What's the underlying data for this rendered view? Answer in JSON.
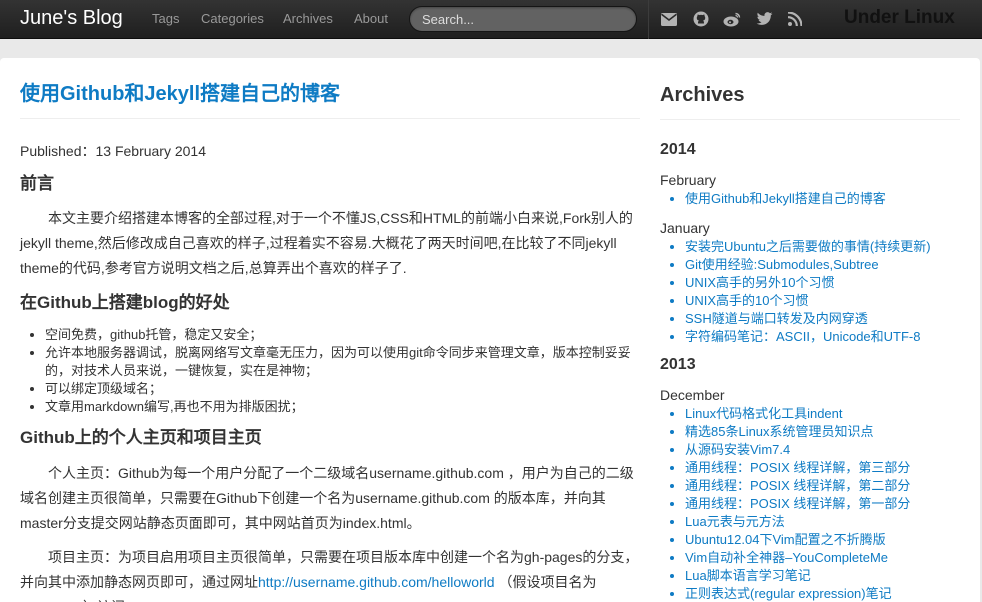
{
  "navbar": {
    "brand": "June's Blog",
    "links": [
      "Tags",
      "Categories",
      "Archives",
      "About"
    ],
    "search_placeholder": "Search...",
    "icons": [
      "envelope-icon",
      "github-icon",
      "weibo-icon",
      "twitter-icon",
      "rss-icon"
    ],
    "right_text": "Under Linux"
  },
  "colors": {
    "link": "#0e7bc4",
    "navbar": "#2b2b2b",
    "background": "#e9e9e9"
  },
  "post": {
    "title": "使用Github和Jekyll搭建自己的博客",
    "published": "Published：13 February 2014",
    "sections": [
      {
        "heading": "前言",
        "para": "本文主要介绍搭建本博客的全部过程,对于一个不懂JS,CSS和HTML的前端小白来说,Fork别人的jekyll theme,然后修改成自己喜欢的样子,过程着实不容易.大概花了两天时间吧,在比较了不同jekyll theme的代码,参考官方说明文档之后,总算弄出个喜欢的样子了."
      },
      {
        "heading": "在Github上搭建blog的好处",
        "items": [
          "空间免费，github托管，稳定又安全；",
          "允许本地服务器调试，脱离网络写文章毫无压力，因为可以使用git命令同步来管理文章，版本控制妥妥的，对技术人员来说，一键恢复，实在是神物；",
          "可以绑定顶级域名；",
          "文章用markdown编写,再也不用为排版困扰；"
        ]
      },
      {
        "heading": "Github上的个人主页和项目主页",
        "para1": "个人主页：Github为每一个用户分配了一个二级域名username.github.com ，用户为自己的二级域名创建主页很简单，只需要在Github下创建一个名为username.github.com 的版本库，并向其master分支提交网站静态页面即可，其中网站首页为index.html。",
        "para2_before": "项目主页：为项目启用项目主页很简单，只需要在项目版本库中创建一个名为gh-pages的分支，并向其中添加静态网页即可，通过网址",
        "para2_link": "http://username.github.com/helloworld",
        "para2_after": " （假设项目名为helloworld）访问。"
      }
    ]
  },
  "sidebar": {
    "title": "Archives",
    "years": [
      {
        "year": "2014",
        "months": [
          {
            "month": "February",
            "posts": [
              "使用Github和Jekyll搭建自己的博客"
            ]
          },
          {
            "month": "January",
            "posts": [
              "安装完Ubuntu之后需要做的事情(持续更新)",
              "Git使用经验:Submodules,Subtree",
              "UNIX高手的另外10个习惯",
              "UNIX高手的10个习惯",
              "SSH隧道与端口转发及内网穿透",
              "字符编码笔记：ASCII，Unicode和UTF-8"
            ]
          }
        ]
      },
      {
        "year": "2013",
        "months": [
          {
            "month": "December",
            "posts": [
              "Linux代码格式化工具indent",
              "精选85条Linux系统管理员知识点",
              "从源码安装Vim7.4",
              "通用线程：POSIX 线程详解，第三部分",
              "通用线程：POSIX 线程详解，第二部分",
              "通用线程：POSIX 线程详解，第一部分",
              "Lua元表与元方法",
              "Ubuntu12.04下Vim配置之不折腾版",
              "Vim自动补全神器–YouCompleteMe",
              "Lua脚本语言学习笔记",
              "正则表达式(regular expression)笔记"
            ]
          }
        ]
      }
    ]
  }
}
